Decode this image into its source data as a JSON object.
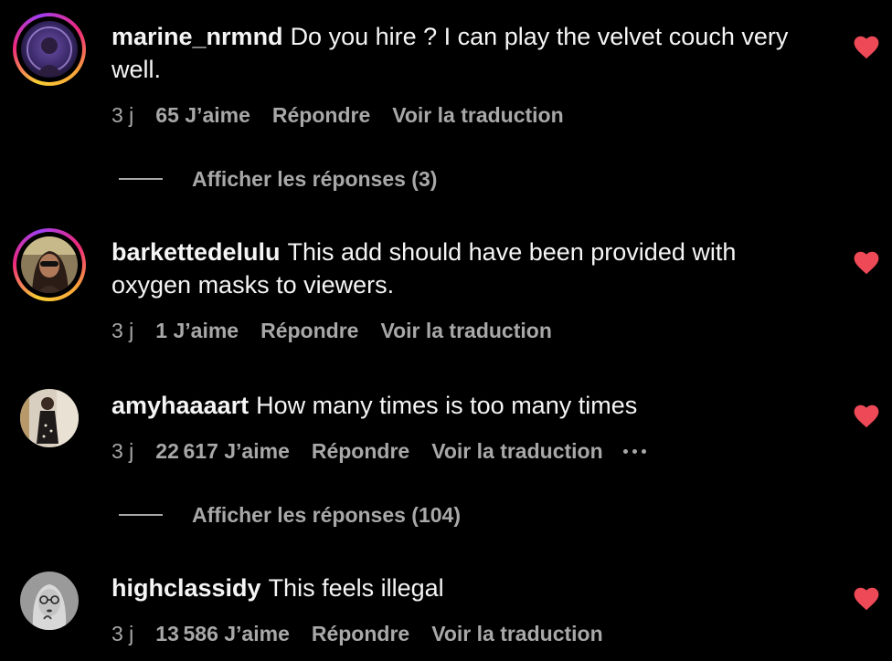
{
  "colors": {
    "background": "#000000",
    "text": "#f5f5f5",
    "muted": "#a8a8a8",
    "like": "#ed4956"
  },
  "comments": [
    {
      "username": "marine_nrmnd",
      "text": "Do you hire ? I can play the velvet couch very well.",
      "time": "3 j",
      "likes": "65 J’aime",
      "reply": "Répondre",
      "translate": "Voir la traduction",
      "replies_label": "Afficher les réponses (3)",
      "avatar_icon": "avatar-with-story-ring",
      "liked": true
    },
    {
      "username": "barkettedelulu",
      "text": "This add should have been provided with oxygen masks to viewers.",
      "time": "3 j",
      "likes": "1 J’aime",
      "reply": "Répondre",
      "translate": "Voir la traduction",
      "avatar_icon": "avatar-with-story-ring",
      "liked": true
    },
    {
      "username": "amyhaaaart",
      "text": "How many times is too many times",
      "time": "3 j",
      "likes": "22 617 J’aime",
      "reply": "Répondre",
      "translate": "Voir la traduction",
      "more_icon": "more-dots-icon",
      "replies_label": "Afficher les réponses (104)",
      "avatar_icon": "avatar",
      "liked": true
    },
    {
      "username": "highclassidy",
      "text": "This feels illegal",
      "time": "3 j",
      "likes": "13 586 J’aime",
      "reply": "Répondre",
      "translate": "Voir la traduction",
      "avatar_icon": "avatar",
      "liked": true
    }
  ]
}
